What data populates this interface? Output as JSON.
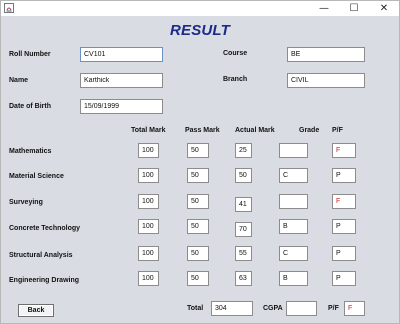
{
  "window": {
    "icon": "java-icon",
    "controls": {
      "minimize": "—",
      "maximize": "☐",
      "close": "✕"
    }
  },
  "title": "RESULT",
  "student": {
    "roll_label": "Roll Number",
    "roll_value": "CV101",
    "course_label": "Course",
    "course_value": "BE",
    "name_label": "Name",
    "name_value": "Karthick",
    "branch_label": "Branch",
    "branch_value": "CIVIL",
    "dob_label": "Date of Birth",
    "dob_value": "15/09/1999"
  },
  "headers": {
    "total_mark": "Total Mark",
    "pass_mark": "Pass Mark",
    "actual_mark": "Actual Mark",
    "grade": "Grade",
    "pf": "P/F"
  },
  "subjects": [
    {
      "name": "Mathematics",
      "total": "100",
      "pass": "50",
      "actual": "25",
      "grade": "",
      "pf": "F"
    },
    {
      "name": "Material Science",
      "total": "100",
      "pass": "50",
      "actual": "50",
      "grade": "C",
      "pf": "P"
    },
    {
      "name": "Surveying",
      "total": "100",
      "pass": "50",
      "actual": "41",
      "grade": "",
      "pf": "F"
    },
    {
      "name": "Concrete Technology",
      "total": "100",
      "pass": "50",
      "actual": "70",
      "grade": "B",
      "pf": "P"
    },
    {
      "name": "Structural Analysis",
      "total": "100",
      "pass": "50",
      "actual": "55",
      "grade": "C",
      "pf": "P"
    },
    {
      "name": "Engineering Drawing",
      "total": "100",
      "pass": "50",
      "actual": "63",
      "grade": "B",
      "pf": "P"
    }
  ],
  "footer": {
    "back_label": "Back",
    "total_label": "Total",
    "total_value": "304",
    "cgpa_label": "CGPA",
    "cgpa_value": "",
    "pf_label": "P/F",
    "pf_value": "F"
  },
  "colors": {
    "title": "#1c2a8a",
    "fail": "#cc2020",
    "background": "#d9dde3"
  }
}
